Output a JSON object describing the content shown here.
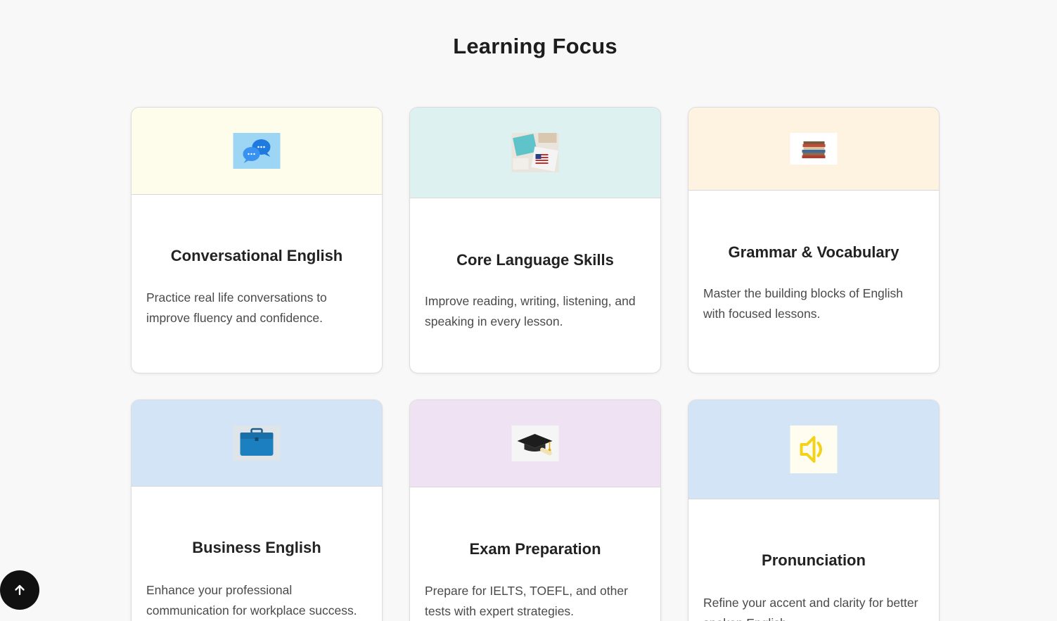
{
  "section": {
    "title": "Learning Focus"
  },
  "cards": [
    {
      "title": "Conversational English",
      "description": "Practice real life conversations to improve fluency and confidence.",
      "icon": "chat-bubbles-icon",
      "header_color": "#fefdec"
    },
    {
      "title": "Core Language Skills",
      "description": "Improve reading, writing, listening, and speaking in every lesson.",
      "icon": "books-with-flag-icon",
      "header_color": "#def1f1"
    },
    {
      "title": "Grammar & Vocabulary",
      "description": "Master the building blocks of English with focused lessons.",
      "icon": "book-stack-icon",
      "header_color": "#fef2e1"
    },
    {
      "title": "Business English",
      "description": "Enhance your professional communication for workplace success.",
      "icon": "briefcase-icon",
      "header_color": "#d2e4f6"
    },
    {
      "title": "Exam Preparation",
      "description": "Prepare for IELTS, TOEFL, and other tests with expert strategies.",
      "icon": "graduation-cap-icon",
      "header_color": "#efe3f3"
    },
    {
      "title": "Pronunciation",
      "description": "Refine your accent and clarity for better spoken English.",
      "icon": "speaker-icon",
      "header_color": "#d2e4f6"
    }
  ],
  "scroll_top": {
    "icon": "arrow-up-icon"
  },
  "colors": {
    "page_background": "#f8f8f8",
    "scroll_button": "#111111"
  }
}
